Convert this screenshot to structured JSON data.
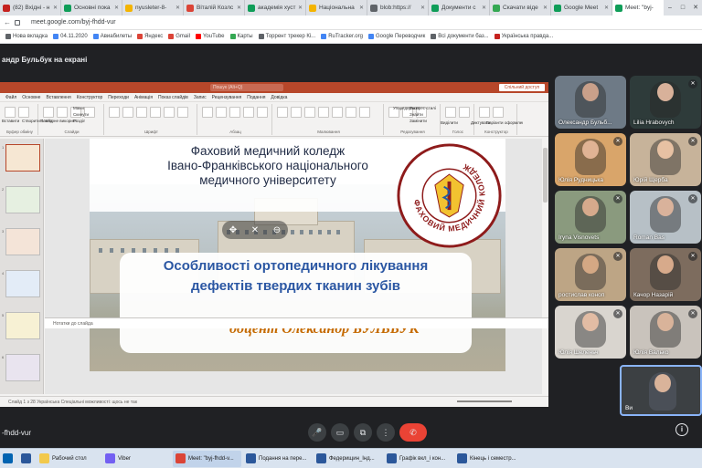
{
  "browser": {
    "tabs": [
      {
        "label": "(82) Вхідні - н",
        "color": "#c5221f"
      },
      {
        "label": "Основні пока",
        "color": "#0f9d58"
      },
      {
        "label": "nyusleter-8-",
        "color": "#f4b400"
      },
      {
        "label": "Віталій Козлс",
        "color": "#db4437"
      },
      {
        "label": "академія хуст",
        "color": "#0f9d58"
      },
      {
        "label": "Національна",
        "color": "#f4b400"
      },
      {
        "label": "blob:https://",
        "color": "#5f6368"
      },
      {
        "label": "Документи с",
        "color": "#0f9d58"
      },
      {
        "label": "Скачати віде",
        "color": "#34a853"
      },
      {
        "label": "Google Meet",
        "color": "#0f9d58"
      },
      {
        "label": "Meet: \"byj-",
        "color": "#0f9d58"
      }
    ],
    "url": "meet.google.com/byj-fhdd-vur",
    "bookmarks": [
      {
        "label": "Нова вкладка",
        "color": "#5f6368"
      },
      {
        "label": "04.11.2020",
        "color": "#4285f4"
      },
      {
        "label": "Авиабилеты",
        "color": "#4285f4"
      },
      {
        "label": "Яндекс",
        "color": "#db4437"
      },
      {
        "label": "Gmail",
        "color": "#db4437"
      },
      {
        "label": "YouTube",
        "color": "#ff0000"
      },
      {
        "label": "Карты",
        "color": "#34a853"
      },
      {
        "label": "Торрент трекер Кі...",
        "color": "#5f6368"
      },
      {
        "label": "RuTracker.org",
        "color": "#4285f4"
      },
      {
        "label": "Google Переводчик",
        "color": "#4285f4"
      },
      {
        "label": "Всі документи баз...",
        "color": "#5f6368"
      },
      {
        "label": "Українська правда...",
        "color": "#c5221f"
      }
    ]
  },
  "meet": {
    "presenting_label": "андр Бульбук на екрані",
    "meeting_code": "-fhdd-vur",
    "participants": [
      {
        "name": "Олександр Бульб...",
        "bg": "#6e7a86",
        "skin": "#c9a08a",
        "muted": false
      },
      {
        "name": "Lilia Hrabovych",
        "bg": "#2e3b3a",
        "skin": "#d8b19a",
        "muted": true
      },
      {
        "name": "Юлія Рудницька",
        "bg": "#d9a56a",
        "skin": "#e0b394",
        "muted": true
      },
      {
        "name": "Юрій Щерба",
        "bg": "#c7b39a",
        "skin": "#e7c1a3",
        "muted": true
      },
      {
        "name": "Iryna Visnovets",
        "bg": "#8a9a7e",
        "skin": "#d6aa8c",
        "muted": true
      },
      {
        "name": "Roman Bas",
        "bg": "#b7c0c6",
        "skin": "#d9b29b",
        "muted": true
      },
      {
        "name": "ростислав коноп",
        "bg": "#bda585",
        "skin": "#d4a884",
        "muted": true
      },
      {
        "name": "Качор Назарій",
        "bg": "#7d6c5e",
        "skin": "#d7aa8b",
        "muted": true
      },
      {
        "name": "Юлія Шеленьч",
        "bg": "#d9d5cf",
        "skin": "#e2bca4",
        "muted": true
      },
      {
        "name": "Юлія Валько",
        "bg": "#c9c3bc",
        "skin": "#d9b39a",
        "muted": true
      }
    ],
    "self_name": "Ви",
    "controls": {
      "mic": "🎤",
      "camera": "▭",
      "present": "⧉",
      "more": "⋮",
      "end": "✆",
      "info": "i"
    }
  },
  "powerpoint": {
    "search_placeholder": "Пошук (Alt+Q)",
    "share_label": "Спільний доступ",
    "menu": [
      "Файл",
      "Основне",
      "Вставлення",
      "Конструктор",
      "Переходи",
      "Анімація",
      "Показ слайдів",
      "Запис",
      "Рецензування",
      "Подання",
      "Довідка"
    ],
    "ribbon_groups": [
      "Буфер обміну",
      "Слайди",
      "Шрифт",
      "Абзац",
      "Малювання",
      "Редагування",
      "Голос",
      "Конструктор"
    ],
    "ribbon_buttons": [
      "Вставити",
      "Створити слайд",
      "Повторне використання слайдів",
      "Макет",
      "Скинути",
      "Розділ",
      "Упорядкувати",
      "Експрес-стилі",
      "Знайти",
      "Замінити",
      "Виділити",
      "Диктувати",
      "Варіанти оформлення"
    ],
    "slide_numbers": [
      "1",
      "2",
      "3",
      "4",
      "5",
      "6"
    ],
    "notes_placeholder": "Нотатки до слайда",
    "status_text": "Слайд 1 з 28   Українська   Спеціальні можливості: щось не так",
    "slide": {
      "college_lines": [
        "Фаховий медичний коледж",
        "Івано-Франківського національного",
        "медичного університету"
      ],
      "logo_text": "ФАХОВИЙ МЕДИЧНИЙ КОЛЕДЖ",
      "topic_lines": [
        "Особливості ортопедичного лікування",
        "дефектів твердих тканин зубів"
      ],
      "author": "доцент Олександр БУЛЬБУК"
    }
  },
  "taskbar": {
    "items": [
      {
        "label": "",
        "color": "#0063b1"
      },
      {
        "label": "",
        "color": "#2b579a"
      },
      {
        "label": "Рабочий стол",
        "color": "#f2c94c"
      },
      {
        "label": "Viber",
        "color": "#7360f2"
      },
      {
        "label": "Meet: \"byj-fhdd-v...",
        "color": "#db4437"
      },
      {
        "label": "Подання на пере...",
        "color": "#2b579a"
      },
      {
        "label": "Федерищин_Інд...",
        "color": "#2b579a"
      },
      {
        "label": "Графік вкл_і кон...",
        "color": "#2b579a"
      },
      {
        "label": "Кінець і семестр...",
        "color": "#2b579a"
      }
    ]
  },
  "colors": {
    "meet_bg": "#202124",
    "ppt_accent": "#b7472a",
    "end_call": "#ea4335",
    "topic_blue": "#2b57a3",
    "author_orange": "#c56a00"
  }
}
